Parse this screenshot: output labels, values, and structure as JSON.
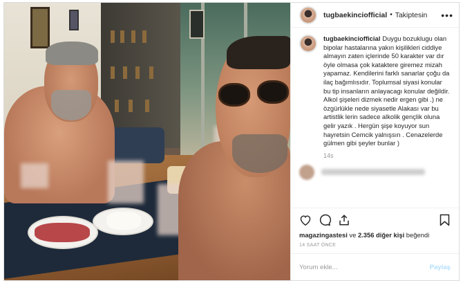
{
  "header": {
    "username": "tugbaekinciofficial",
    "separator": "•",
    "follow_status": "Takiptesin",
    "more": "•••"
  },
  "caption": {
    "username": "tugbaekinciofficial",
    "text": "Duygu bozuklugu olan bipolar hastalarına yakın kişilikleri ciddiye almayın zaten içlerinde 50 karakter var dır öyle olmasa çok kataktere giremez mizah yapamaz. Kendilerini farklı sanarlar çoğu da ilaç bağımlısıdır. Toplumsal siyasi konular bu tip insanların anlayacagı konular değildir. Alkol şişeleri dizmek nedir ergen gibi .) ne özgürlükle nede siyasetle Alakası var bu artistlik lerin sadece alkolik gençlik oluna gelir yazık . Hergün şişe koyuyor sun hayretsin Cemcik yalnışsın . Cenazelerde gülmen gibi şeyler bunlar )",
    "time": "14s"
  },
  "likes": {
    "user": "magazingastesi",
    "connector": " ve ",
    "others": "2.356 diğer kişi",
    "suffix": " beğendi"
  },
  "timestamp": "14 SAAT ÖNCE",
  "comment_box": {
    "placeholder": "Yorum ekle...",
    "post_label": "Paylaş"
  },
  "icons": {
    "like": "heart-icon",
    "comment": "comment-icon",
    "share": "share-icon",
    "save": "bookmark-icon",
    "more": "more-options-icon"
  }
}
